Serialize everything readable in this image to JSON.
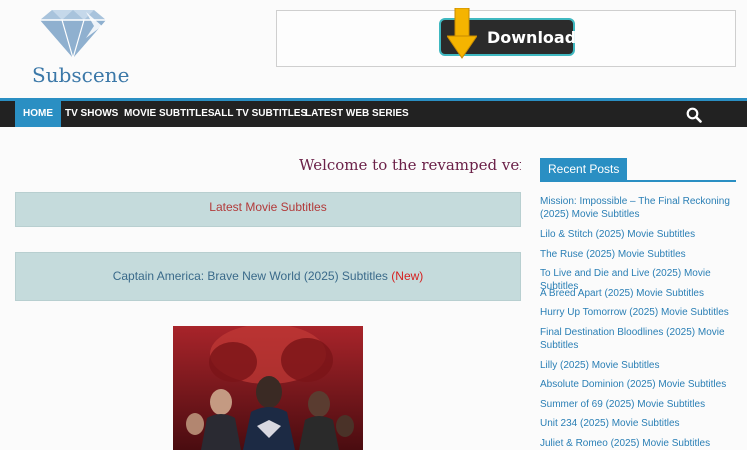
{
  "site": {
    "logo_text": "Subscene"
  },
  "banner": {
    "download_label": "Download"
  },
  "nav": {
    "items": [
      {
        "label": "HOME"
      },
      {
        "label": "TV SHOWS"
      },
      {
        "label": "MOVIE SUBTITLES"
      },
      {
        "label": "ALL TV SUBTITLES"
      },
      {
        "label": "LATEST WEB SERIES"
      }
    ],
    "search_icon": "search-icon"
  },
  "main": {
    "welcome": "Welcome to the revamped versio",
    "latest_heading": "Latest Movie Subtitles",
    "featured": {
      "title": "Captain America: Brave New World (2025) Subtitles",
      "badge": "(New)"
    }
  },
  "sidebar": {
    "recent_posts_title": "Recent Posts",
    "posts": [
      {
        "label": "Mission: Impossible – The Final Reckoning (2025) Movie Subtitles"
      },
      {
        "label": "Lilo & Stitch (2025) Movie Subtitles"
      },
      {
        "label": "The Ruse (2025) Movie Subtitles"
      },
      {
        "label": "To Live and Die and Live (2025) Movie Subtitles"
      },
      {
        "label": "A Breed Apart (2025) Movie Subtitles"
      },
      {
        "label": "Hurry Up Tomorrow (2025) Movie Subtitles"
      },
      {
        "label": "Final Destination Bloodlines (2025) Movie Subtitles"
      },
      {
        "label": "Lilly (2025) Movie Subtitles"
      },
      {
        "label": "Absolute Dominion (2025) Movie Subtitles"
      },
      {
        "label": "Summer of 69 (2025) Movie Subtitles"
      },
      {
        "label": "Unit 234 (2025) Movie Subtitles"
      },
      {
        "label": "Juliet & Romeo (2025) Movie Subtitles"
      }
    ]
  },
  "colors": {
    "accent": "#2a8fc3",
    "nav_bg": "#222222",
    "box_bg": "#c5dbdc",
    "link": "#2a7fb5"
  }
}
